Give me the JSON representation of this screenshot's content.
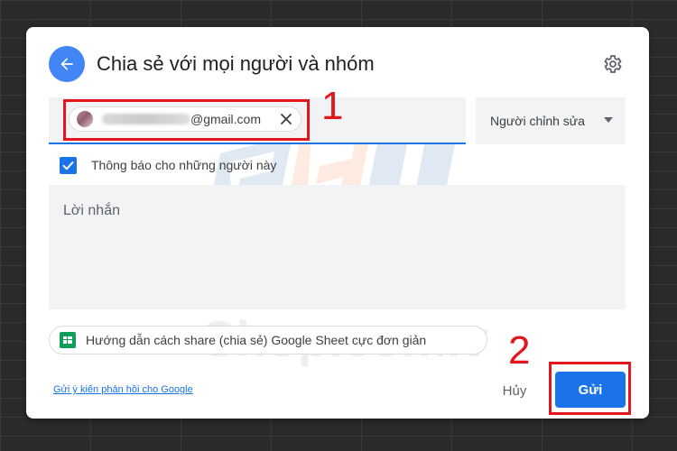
{
  "colors": {
    "accent": "#1a73e8",
    "back_button": "#4285f4",
    "annotation": "#e4151c",
    "sheets_green": "#0f9d58",
    "watermark_orange": "#f26f21",
    "watermark_blue": "#1a5aa8"
  },
  "dialog": {
    "title": "Chia sẻ với mọi người và nhóm",
    "back_icon": "arrow-left-icon",
    "settings_icon": "gear-icon"
  },
  "recipient": {
    "email_suffix": "@gmail.com",
    "remove_icon": "close-icon",
    "role_label": "Người chỉnh sửa",
    "role_icon": "caret-down-icon"
  },
  "notify": {
    "checked": true,
    "label": "Thông báo cho những người này"
  },
  "message": {
    "placeholder": "Lời nhắn"
  },
  "guide": {
    "label": "Hướng dẫn cách share (chia sẻ) Google Sheet cực đơn giản",
    "icon": "google-sheets-icon"
  },
  "footer": {
    "feedback_link": "Gửi ý kiến phản hồi cho Google",
    "cancel_label": "Hủy",
    "send_label": "Gửi"
  },
  "annotations": {
    "step1": "1",
    "step2": "2"
  },
  "watermark": {
    "text": "Shop.com.vn"
  }
}
